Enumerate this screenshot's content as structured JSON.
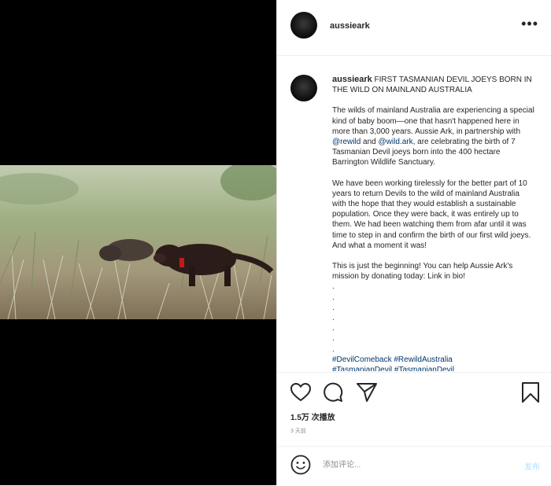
{
  "post": {
    "username": "aussieark",
    "more_label": "•••",
    "caption_title": "FIRST TASMANIAN DEVIL JOEYS BORN IN THE WILD ON MAINLAND AUSTRALIA",
    "para1_a": "The wilds of mainland Australia are experiencing a special kind of baby boom—one that hasn't happened here in more than 3,000 years. Aussie Ark, in partnership with ",
    "mention1": "@rewild",
    "para1_b": " and ",
    "mention2": "@wild.ark",
    "para1_c": ", are celebrating the birth of 7 Tasmanian Devil joeys born into the 400 hectare Barrington Wildlife Sanctuary.",
    "para2": "We have been working tirelessly for the better part of 10 years to return Devils to the wild of mainland Australia with the hope that they would establish a sustainable population. Once they were back, it was entirely up to them. We had been watching them from afar until it was time to step in and confirm the birth of our first wild joeys. And what a moment it was!",
    "para3": "This is just the beginning! You can help Aussie Ark's mission by donating today: Link in bio!",
    "dot": ".",
    "hashtag1": "#DevilComeback",
    "hashtag2": "#RewildAustralia",
    "hashtag3": "#TasmanianDevil #TasmanianDevil",
    "views": "1.5万 次播放",
    "time": "3 天前",
    "comment_placeholder": "添加评论...",
    "post_button": "发布"
  },
  "icons": {
    "like": "heart-icon",
    "comment": "comment-icon",
    "share": "paper-plane-icon",
    "save": "bookmark-icon",
    "emoji": "emoji-icon"
  },
  "colors": {
    "link": "#00376b",
    "muted": "#8e8e8e",
    "post_button": "#b2dffc",
    "border": "#dbdbdb"
  }
}
